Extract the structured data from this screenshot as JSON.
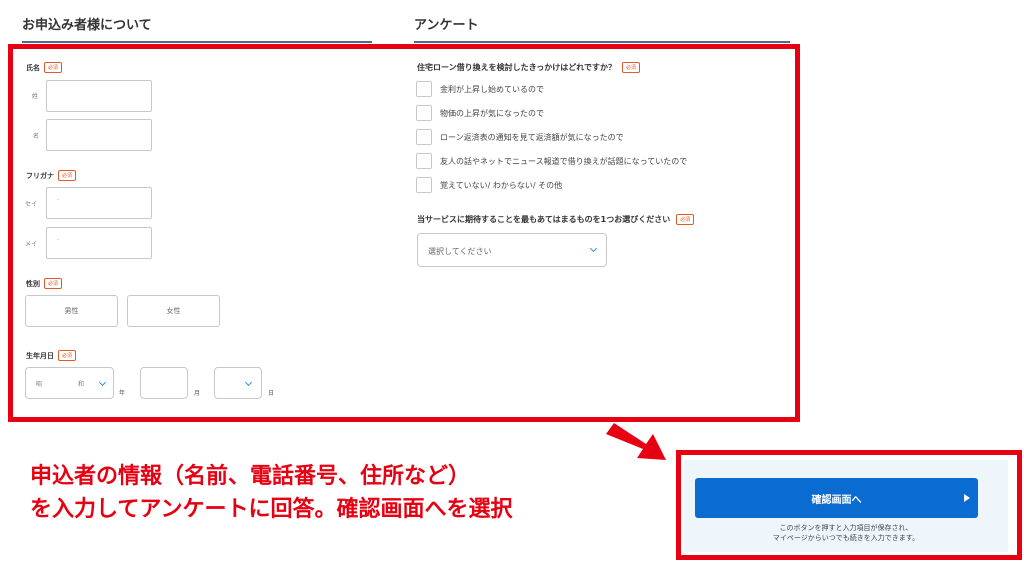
{
  "sections": {
    "applicant_heading": "お申込み者様について",
    "survey_heading": "アンケート"
  },
  "applicant": {
    "required_badge": "必須",
    "name": {
      "label": "氏名",
      "last_label": "姓",
      "first_label": "名"
    },
    "furigana": {
      "label": "フリガナ",
      "sei_label": "セイ",
      "mei_label": "メイ",
      "sei_placeholder": "-",
      "mei_placeholder": "-"
    },
    "gender": {
      "label": "性別",
      "male": "男性",
      "female": "女性"
    },
    "birthdate": {
      "label": "生年月日",
      "era_value": "昭",
      "year_value": "和",
      "year_unit": "年",
      "month_unit": "月",
      "day_unit": "日"
    }
  },
  "survey": {
    "q1": {
      "title": "住宅ローン借り換えを検討したきっかけはどれですか？",
      "options": [
        "金利が上昇し始めているので",
        "物価の上昇が気になったので",
        "ローン返済表の通知を見て返済額が気になったので",
        "友人の話やネットでニュース報道で借り換えが話題になっていたので",
        "覚えていない/ わからない/ その他"
      ]
    },
    "q2": {
      "title": "当サービスに期待することを最もあてはまるものを1つお選びください",
      "select_placeholder": "選択してください"
    }
  },
  "instruction": {
    "line1": "申込者の情報（名前、電話番号、住所など）",
    "line2": "を入力してアンケートに回答。確認画面へを選択"
  },
  "confirm": {
    "button_label": "確認画面へ",
    "note_line1": "このボタンを押すと入力項目が保存され、",
    "note_line2": "マイページからいつでも続きを入力できます。"
  },
  "colors": {
    "highlight_red": "#e60012",
    "primary_blue": "#0a6bd1",
    "required_orange": "#e05a28"
  }
}
